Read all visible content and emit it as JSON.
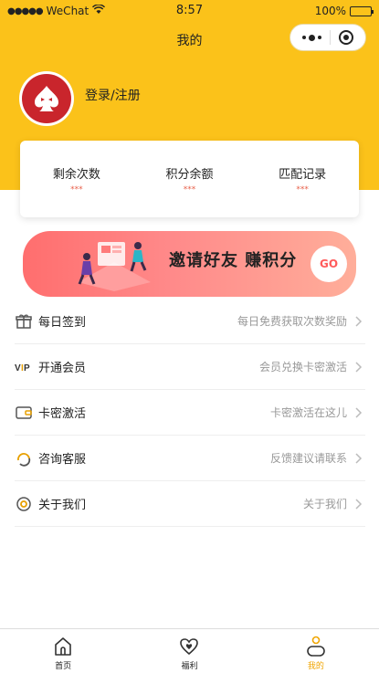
{
  "status": {
    "carrier": "WeChat",
    "time": "8:57",
    "battery": "100%"
  },
  "nav": {
    "title": "我的"
  },
  "profile": {
    "login_label": "登录/注册"
  },
  "stats": [
    {
      "label": "剩余次数",
      "value": "***"
    },
    {
      "label": "积分余额",
      "value": "***"
    },
    {
      "label": "匹配记录",
      "value": "***"
    }
  ],
  "banner": {
    "text": "邀请好友 赚积分",
    "go": "GO"
  },
  "menu": [
    {
      "icon": "gift-icon",
      "label": "每日签到",
      "desc": "每日免费获取次数奖励"
    },
    {
      "icon": "vip-icon",
      "label": "开通会员",
      "desc": "会员兑换卡密激活"
    },
    {
      "icon": "wallet-icon",
      "label": "卡密激活",
      "desc": "卡密激活在这儿"
    },
    {
      "icon": "headset-icon",
      "label": "咨询客服",
      "desc": "反馈建议请联系"
    },
    {
      "icon": "info-circle-icon",
      "label": "关于我们",
      "desc": "关于我们"
    }
  ],
  "tabs": [
    {
      "icon": "home-icon",
      "label": "首页"
    },
    {
      "icon": "heart-icon",
      "label": "福利"
    },
    {
      "icon": "user-icon",
      "label": "我的"
    }
  ],
  "colors": {
    "header": "#FBC21A",
    "accent": "#F0A500",
    "avatar": "#C9252C",
    "stat_value": "#E8604A"
  }
}
